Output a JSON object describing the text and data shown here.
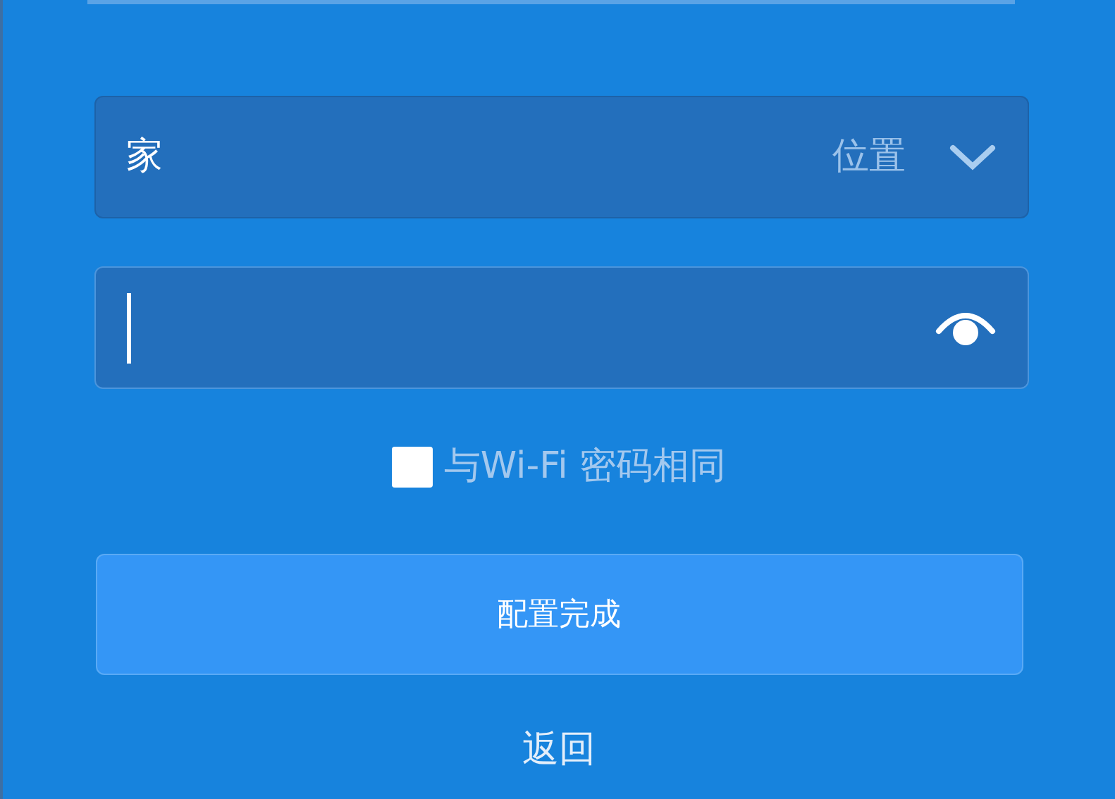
{
  "location_select": {
    "value": "家",
    "label": "位置"
  },
  "password_field": {
    "focused": true
  },
  "same_as_wifi": {
    "label": "与Wi-Fi 密码相同",
    "checked": false
  },
  "submit_button": {
    "label": "配置完成"
  },
  "back_link": {
    "label": "返回"
  }
}
